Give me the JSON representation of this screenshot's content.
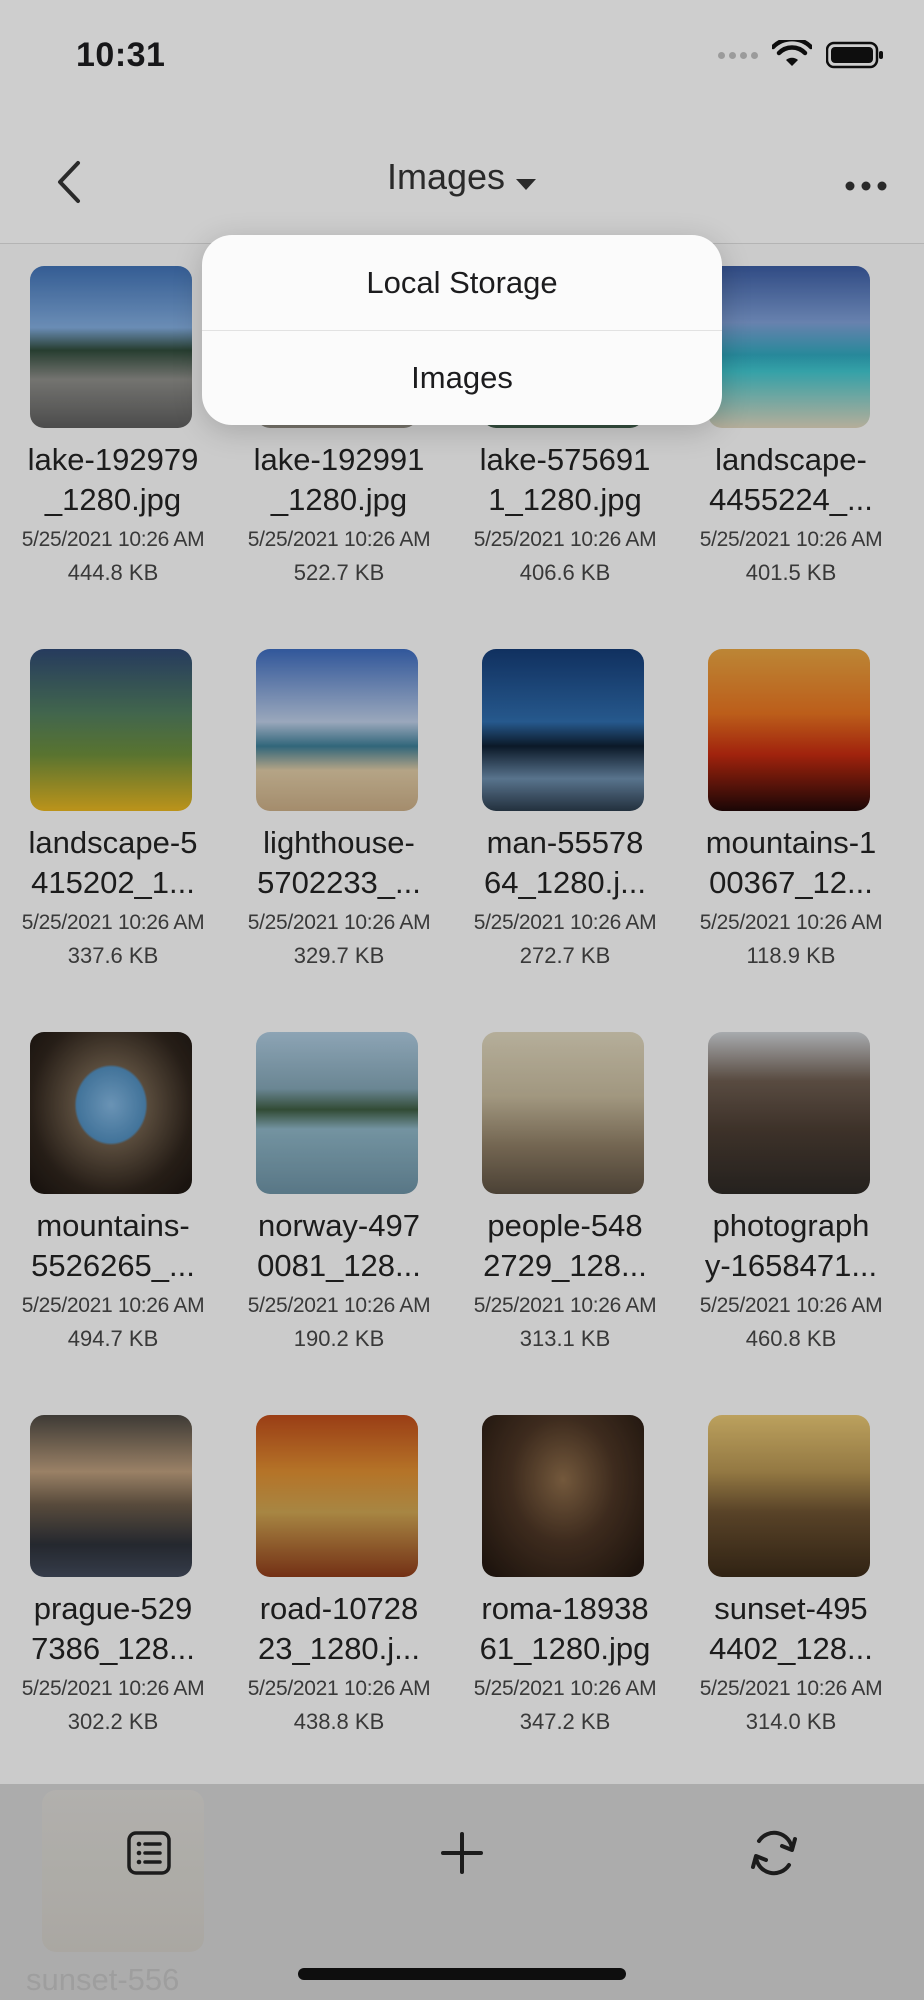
{
  "status_bar": {
    "time": "10:31"
  },
  "nav": {
    "title": "Images"
  },
  "dropdown": {
    "items": [
      "Local Storage",
      "Images"
    ]
  },
  "files": [
    {
      "name_l1": "lake-192979",
      "name_l2": "_1280.jpg",
      "date": "5/25/2021 10:26 AM",
      "size": "444.8 KB"
    },
    {
      "name_l1": "lake-192991",
      "name_l2": "_1280.jpg",
      "date": "5/25/2021 10:26 AM",
      "size": "522.7 KB"
    },
    {
      "name_l1": "lake-575691",
      "name_l2": "1_1280.jpg",
      "date": "5/25/2021 10:26 AM",
      "size": "406.6 KB"
    },
    {
      "name_l1": "landscape-",
      "name_l2": "4455224_...",
      "date": "5/25/2021 10:26 AM",
      "size": "401.5 KB"
    },
    {
      "name_l1": "landscape-5",
      "name_l2": "415202_1...",
      "date": "5/25/2021 10:26 AM",
      "size": "337.6 KB"
    },
    {
      "name_l1": "lighthouse-",
      "name_l2": "5702233_...",
      "date": "5/25/2021 10:26 AM",
      "size": "329.7 KB"
    },
    {
      "name_l1": "man-55578",
      "name_l2": "64_1280.j...",
      "date": "5/25/2021 10:26 AM",
      "size": "272.7 KB"
    },
    {
      "name_l1": "mountains-1",
      "name_l2": "00367_12...",
      "date": "5/25/2021 10:26 AM",
      "size": "118.9 KB"
    },
    {
      "name_l1": "mountains-",
      "name_l2": "5526265_...",
      "date": "5/25/2021 10:26 AM",
      "size": "494.7 KB"
    },
    {
      "name_l1": "norway-497",
      "name_l2": "0081_128...",
      "date": "5/25/2021 10:26 AM",
      "size": "190.2 KB"
    },
    {
      "name_l1": "people-548",
      "name_l2": "2729_128...",
      "date": "5/25/2021 10:26 AM",
      "size": "313.1 KB"
    },
    {
      "name_l1": "photograph",
      "name_l2": "y-1658471...",
      "date": "5/25/2021 10:26 AM",
      "size": "460.8 KB"
    },
    {
      "name_l1": "prague-529",
      "name_l2": "7386_128...",
      "date": "5/25/2021 10:26 AM",
      "size": "302.2 KB"
    },
    {
      "name_l1": "road-10728",
      "name_l2": "23_1280.j...",
      "date": "5/25/2021 10:26 AM",
      "size": "438.8 KB"
    },
    {
      "name_l1": "roma-18938",
      "name_l2": "61_1280.jpg",
      "date": "5/25/2021 10:26 AM",
      "size": "347.2 KB"
    },
    {
      "name_l1": "sunset-495",
      "name_l2": "4402_128...",
      "date": "5/25/2021 10:26 AM",
      "size": "314.0 KB"
    }
  ],
  "partial_item": {
    "name": "sunset-556"
  },
  "toolbar": {
    "icons": [
      "list-icon",
      "plus-icon",
      "refresh-icon"
    ]
  }
}
